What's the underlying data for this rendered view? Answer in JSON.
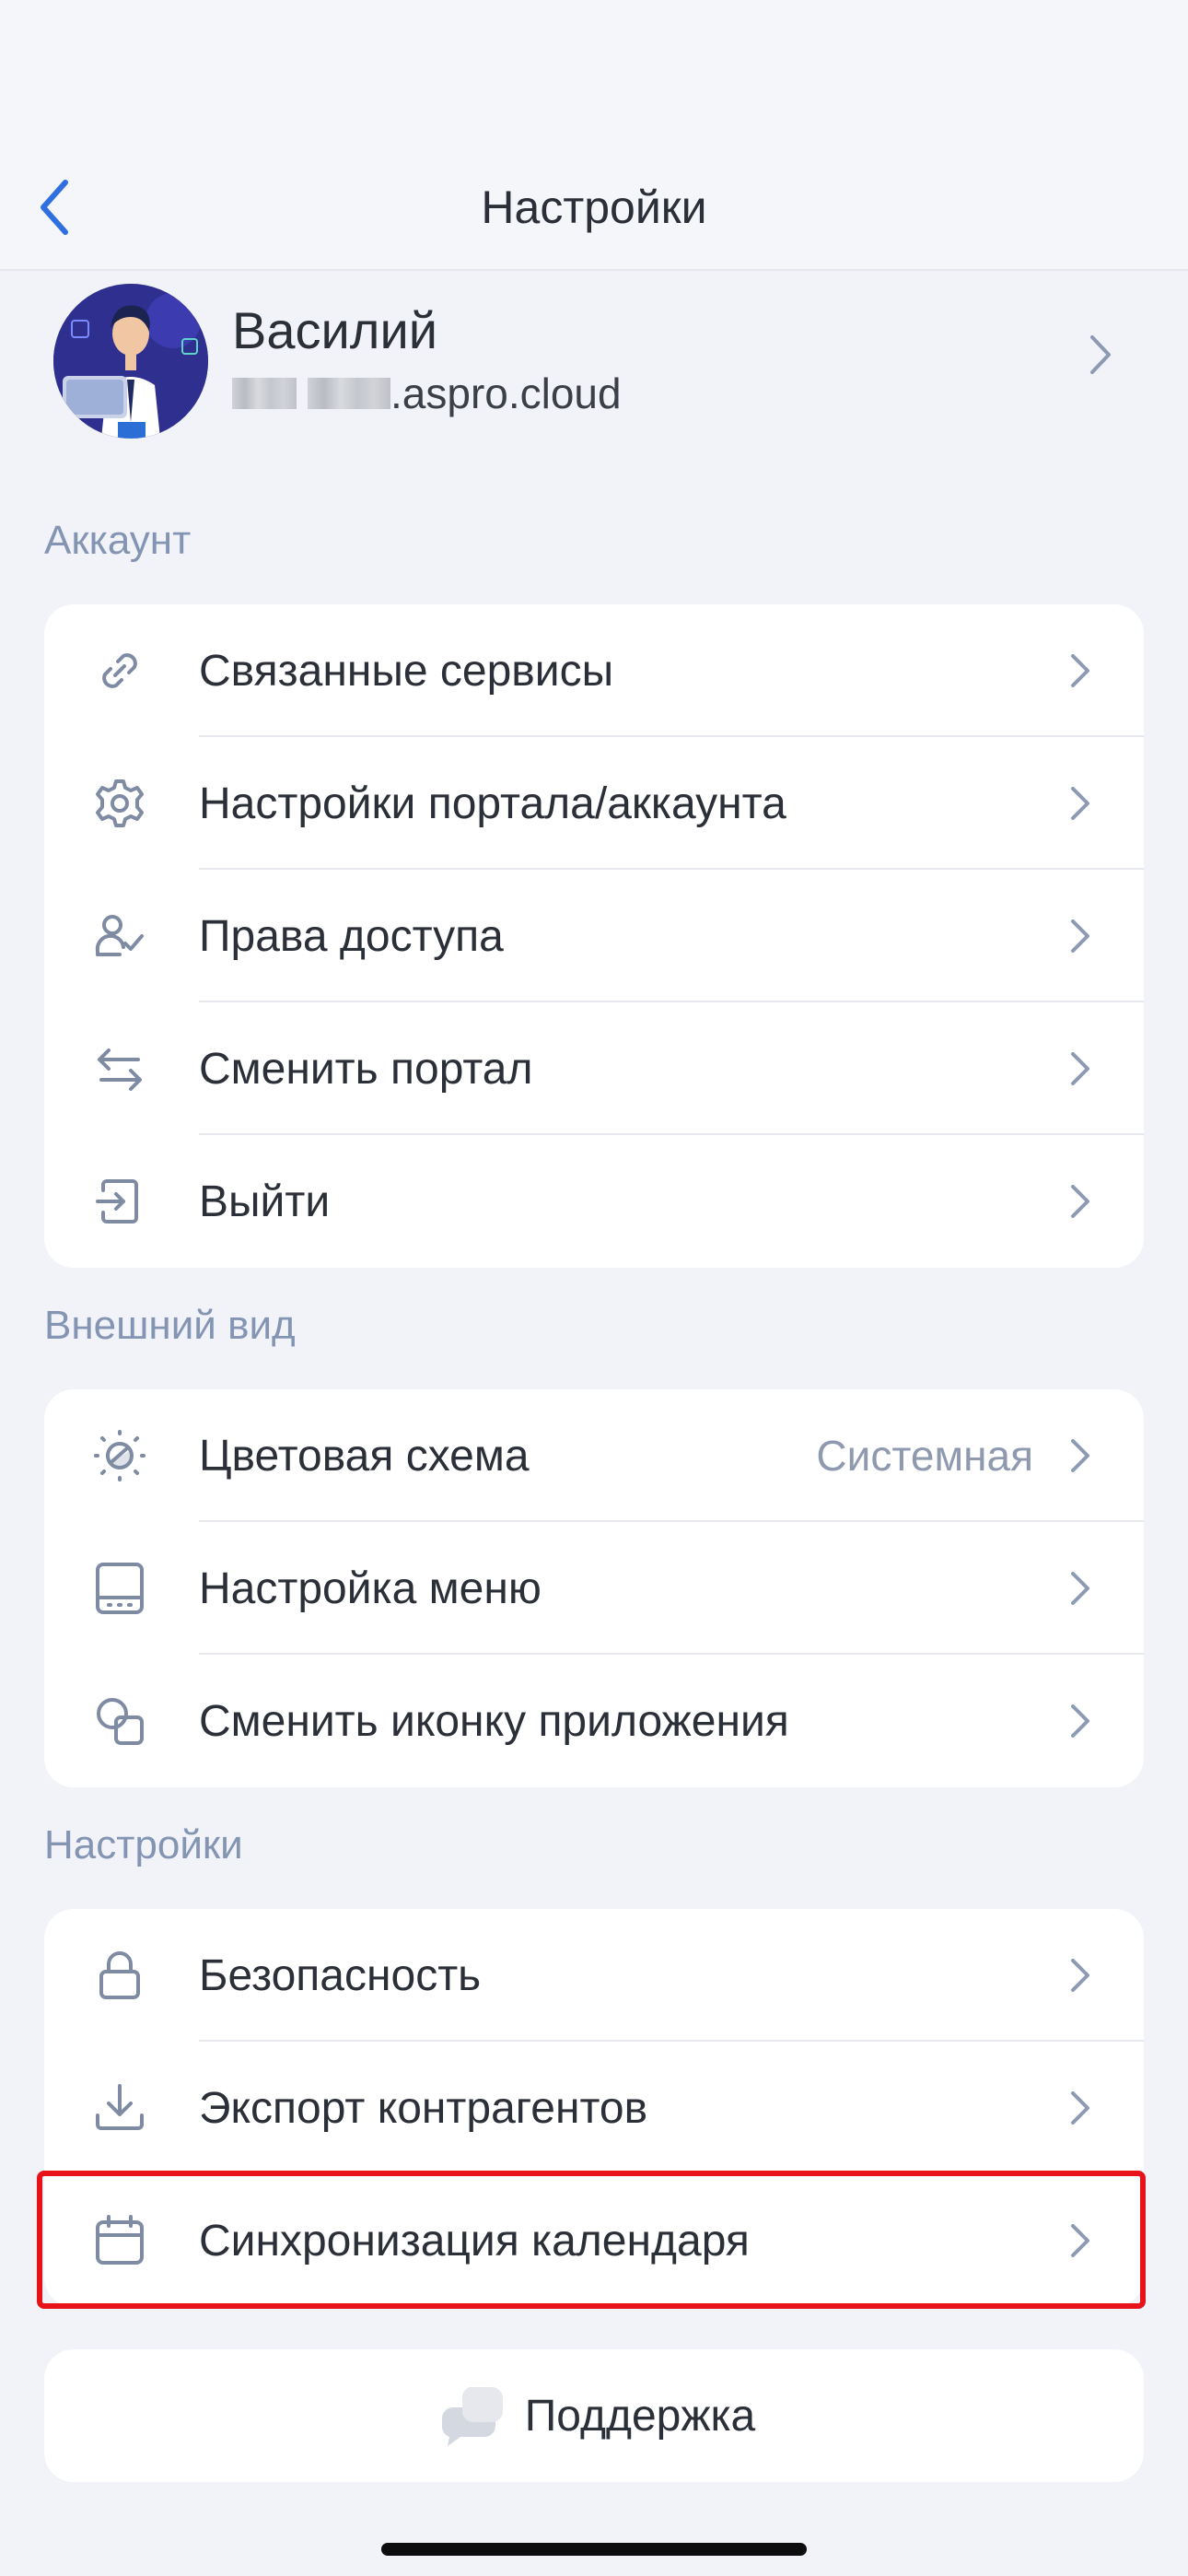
{
  "header": {
    "title": "Настройки",
    "back_icon": "chevron-left-icon"
  },
  "profile": {
    "name": "Василий",
    "domain": ".aspro.cloud"
  },
  "sections": {
    "account": {
      "title": "Аккаунт",
      "items": [
        {
          "label": "Связанные сервисы",
          "icon": "link-icon"
        },
        {
          "label": "Настройки портала/аккаунта",
          "icon": "gear-icon"
        },
        {
          "label": "Права доступа",
          "icon": "user-check-icon"
        },
        {
          "label": "Сменить портал",
          "icon": "swap-arrows-icon"
        },
        {
          "label": "Выйти",
          "icon": "logout-icon"
        }
      ]
    },
    "appearance": {
      "title": "Внешний вид",
      "items": [
        {
          "label": "Цветовая схема",
          "value": "Системная",
          "icon": "color-scheme-icon"
        },
        {
          "label": "Настройка меню",
          "icon": "menu-layout-icon"
        },
        {
          "label": "Сменить иконку приложения",
          "icon": "app-icon-change-icon"
        }
      ]
    },
    "settings": {
      "title": "Настройки",
      "items": [
        {
          "label": "Безопасность",
          "icon": "lock-icon"
        },
        {
          "label": "Экспорт контрагентов",
          "icon": "download-icon"
        },
        {
          "label": "Синхронизация календаря",
          "icon": "calendar-icon"
        }
      ]
    }
  },
  "support": {
    "label": "Поддержка",
    "icon": "chat-bubbles-icon"
  },
  "colors": {
    "background": "#f1f3f8",
    "card": "#ffffff",
    "accent": "#2f6fe0",
    "section_title": "#8494b3",
    "icon": "#7f8ba3",
    "highlight": "#e8121a"
  }
}
